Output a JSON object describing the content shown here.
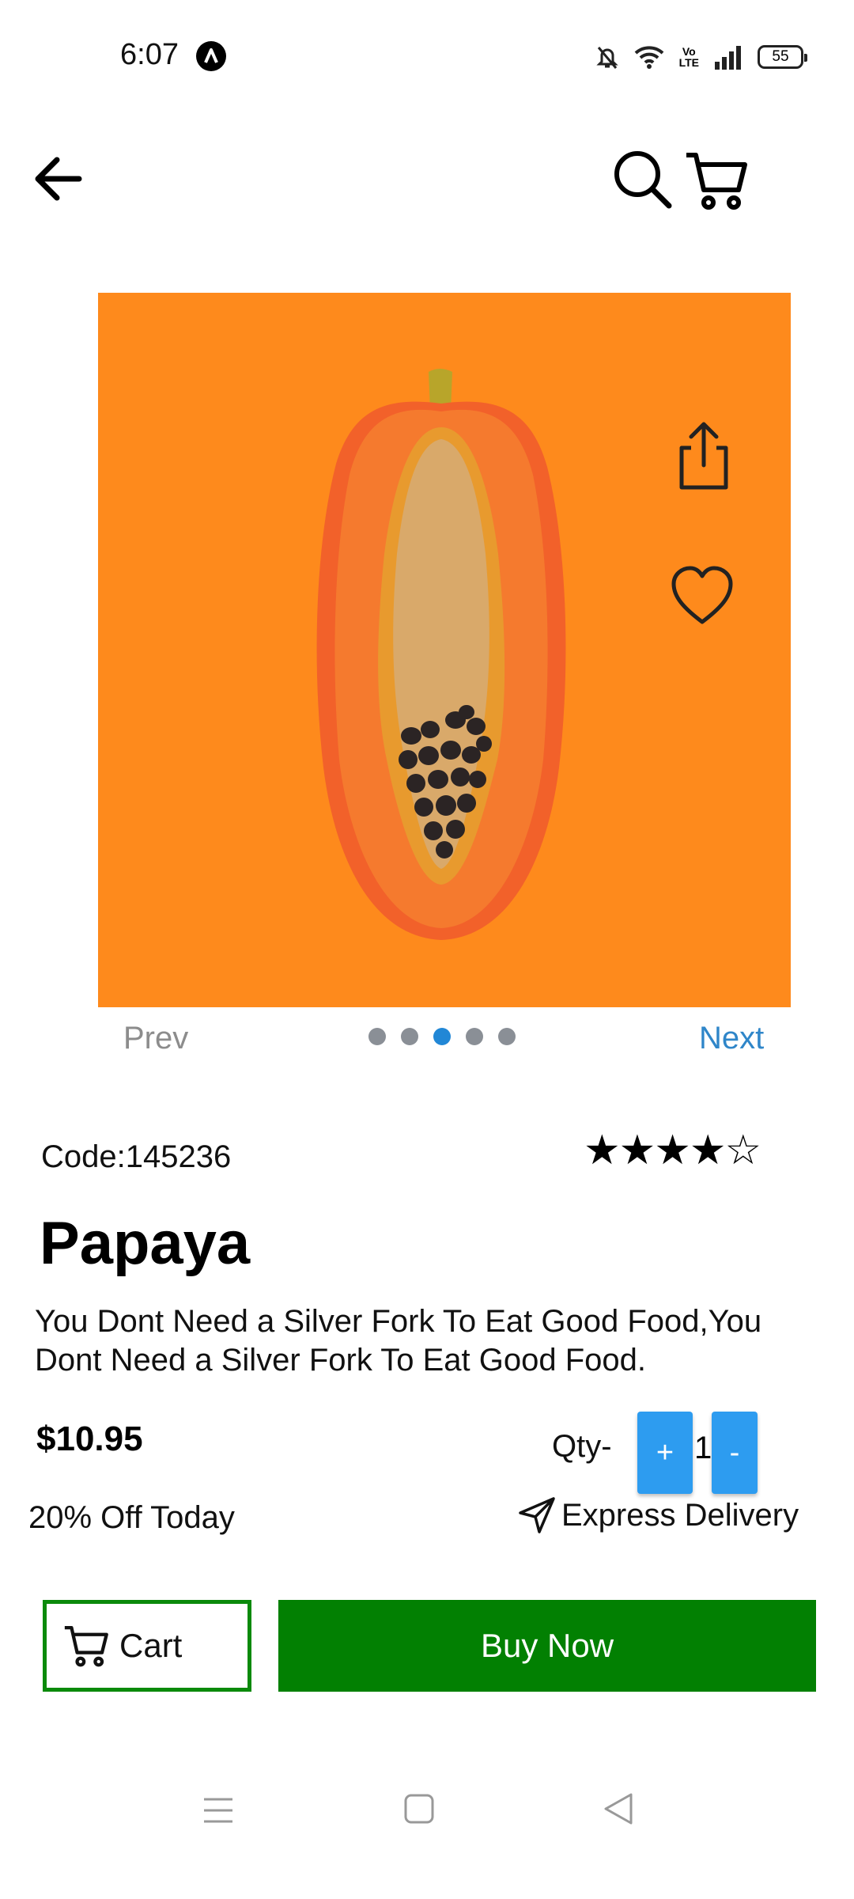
{
  "status_bar": {
    "time": "6:07",
    "battery": "55",
    "volte_top": "Vo",
    "volte_bottom": "LTE"
  },
  "app_bar": {
    "back_icon": "arrow-left-icon",
    "search_icon": "search-icon",
    "cart_icon": "cart-icon"
  },
  "gallery": {
    "image_bg": "#fe8a1c",
    "prev_label": "Prev",
    "next_label": "Next",
    "dot_count": 5,
    "active_dot": 3
  },
  "product": {
    "code": "Code:145236",
    "rating": "★★★★☆",
    "rating_value": 4,
    "name": "Papaya",
    "description": "You Dont Need a Silver Fork To Eat Good Food,You Dont Need a Silver Fork To Eat Good Food.",
    "price": "$10.95",
    "qty_label": "Qty-",
    "qty_plus": "+",
    "qty_value": "1",
    "qty_minus": "-",
    "discount": "20% Off Today",
    "delivery": "Express Delivery"
  },
  "actions": {
    "cart_label": "Cart",
    "buy_label": "Buy Now"
  },
  "colors": {
    "accent_blue": "#2d9cf0",
    "buy_green": "#028002",
    "image_orange": "#fe8a1c"
  }
}
